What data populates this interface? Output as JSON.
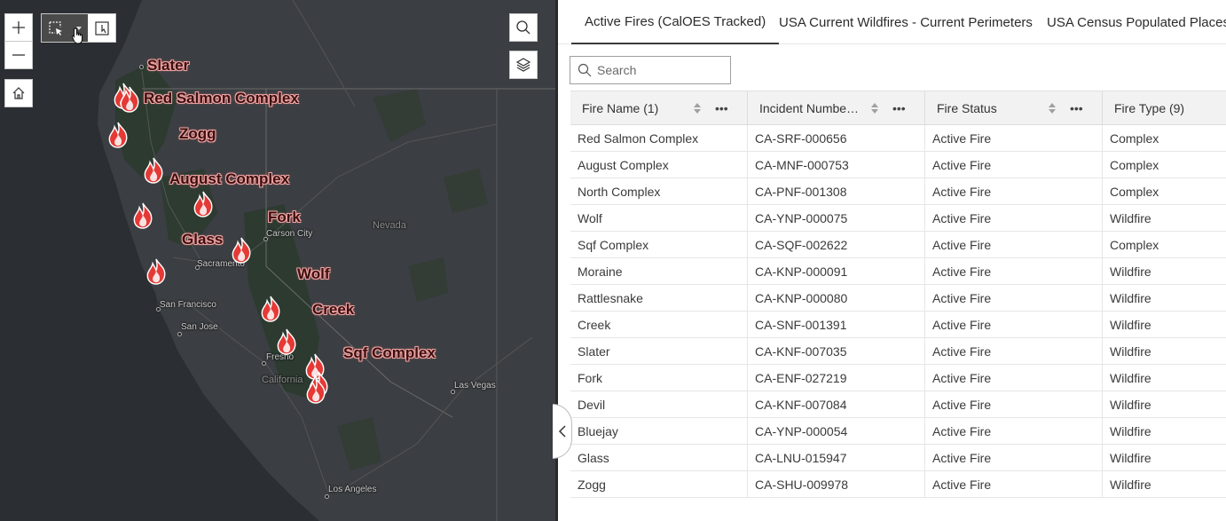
{
  "map": {
    "zoom_in_icon": "plus-icon",
    "zoom_out_icon": "minus-icon",
    "home_icon": "home-icon",
    "search_icon": "search-icon",
    "layers_icon": "layers-icon",
    "select_tool_icon": "cursor-select-icon",
    "dropdown_icon": "chevron-down-icon",
    "lasso_icon": "select-area-icon",
    "places": {
      "carson_city": "Carson City",
      "nevada": "Nevada",
      "sacramento": "Sacramento",
      "san_francisco": "San Francisco",
      "san_jose": "San Jose",
      "fresno": "Fresno",
      "california": "California",
      "las_vegas": "Las Vegas",
      "los_angeles": "Los Angeles"
    },
    "fire_labels": {
      "slater": "Slater",
      "red_salmon": "Red Salmon Complex",
      "zogg": "Zogg",
      "august": "August Complex",
      "fork": "Fork",
      "glass": "Glass",
      "wolf": "Wolf",
      "creek": "Creek",
      "sqf": "Sqf Complex"
    },
    "colors": {
      "fire_marker": "#e53935",
      "fire_label_halo": "#f0a3a3",
      "basemap": "#2e3135"
    }
  },
  "panel": {
    "collapse_icon": "chevron-left-icon",
    "tabs": [
      {
        "label": "Active Fires (CalOES Tracked)"
      },
      {
        "label": "USA Current Wildfires - Current Perimeters"
      },
      {
        "label": "USA Census Populated Places"
      }
    ],
    "search": {
      "placeholder": "Search",
      "icon": "search-icon"
    },
    "table": {
      "columns": [
        {
          "label": "Fire Name (1)"
        },
        {
          "label": "Incident Numbe…"
        },
        {
          "label": "Fire Status"
        },
        {
          "label": "Fire Type (9)"
        }
      ],
      "rows": [
        [
          "Red Salmon Complex",
          "CA-SRF-000656",
          "Active Fire",
          "Complex"
        ],
        [
          "August Complex",
          "CA-MNF-000753",
          "Active Fire",
          "Complex"
        ],
        [
          "North Complex",
          "CA-PNF-001308",
          "Active Fire",
          "Complex"
        ],
        [
          "Wolf",
          "CA-YNP-000075",
          "Active Fire",
          "Wildfire"
        ],
        [
          "Sqf Complex",
          "CA-SQF-002622",
          "Active Fire",
          "Complex"
        ],
        [
          "Moraine",
          "CA-KNP-000091",
          "Active Fire",
          "Wildfire"
        ],
        [
          "Rattlesnake",
          "CA-KNP-000080",
          "Active Fire",
          "Wildfire"
        ],
        [
          "Creek",
          "CA-SNF-001391",
          "Active Fire",
          "Wildfire"
        ],
        [
          "Slater",
          "CA-KNF-007035",
          "Active Fire",
          "Wildfire"
        ],
        [
          "Fork",
          "CA-ENF-027219",
          "Active Fire",
          "Wildfire"
        ],
        [
          "Devil",
          "CA-KNF-007084",
          "Active Fire",
          "Wildfire"
        ],
        [
          "Bluejay",
          "CA-YNP-000054",
          "Active Fire",
          "Wildfire"
        ],
        [
          "Glass",
          "CA-LNU-015947",
          "Active Fire",
          "Wildfire"
        ],
        [
          "Zogg",
          "CA-SHU-009978",
          "Active Fire",
          "Wildfire"
        ]
      ]
    }
  }
}
